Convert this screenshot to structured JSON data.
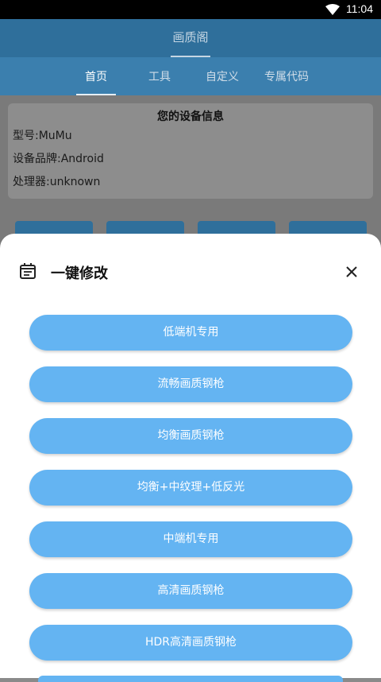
{
  "status": {
    "time": "11:04"
  },
  "app": {
    "title": "画质阁"
  },
  "tabs": [
    {
      "label": "首页"
    },
    {
      "label": "工具"
    },
    {
      "label": "自定义"
    },
    {
      "label": "专属代码"
    }
  ],
  "device": {
    "heading": "您的设备信息",
    "model": "型号:MuMu",
    "brand": "设备品牌:Android",
    "cpu": "处理器:unknown"
  },
  "sheet": {
    "title": "一键修改",
    "options": [
      {
        "label": "低端机专用"
      },
      {
        "label": "流畅画质钢枪"
      },
      {
        "label": "均衡画质钢枪"
      },
      {
        "label": "均衡+中纹理+低反光"
      },
      {
        "label": "中端机专用"
      },
      {
        "label": "高清画质钢枪"
      },
      {
        "label": "HDR高清画质钢枪"
      }
    ]
  },
  "colors": {
    "appbar": "#2f6f9b",
    "tabs": "#3b7fae",
    "option_button": "#64b4f2"
  },
  "icons": [
    "wifi-icon",
    "calendar-icon",
    "close-icon"
  ]
}
